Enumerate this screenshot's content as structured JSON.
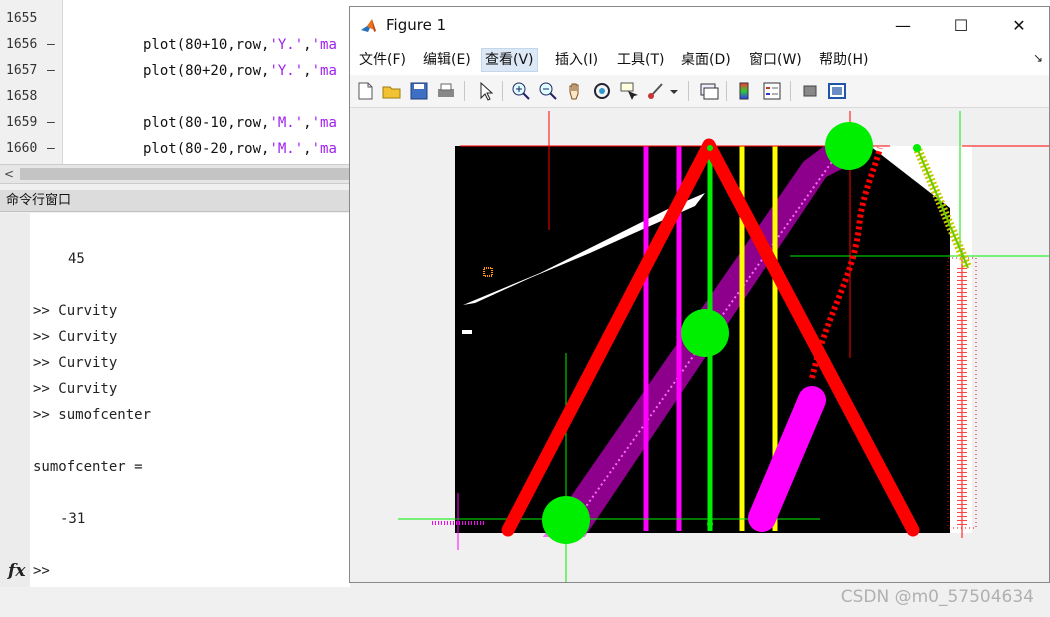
{
  "editor": {
    "lines": [
      {
        "num": "1655",
        "dash": "",
        "code": []
      },
      {
        "num": "1656",
        "dash": "—",
        "code": [
          {
            "t": "plot(80+10,row,",
            "c": "code"
          },
          {
            "t": "'Y.'",
            "c": "str"
          },
          {
            "t": ",",
            "c": "code"
          },
          {
            "t": "'ma",
            "c": "str"
          }
        ]
      },
      {
        "num": "1657",
        "dash": "—",
        "code": [
          {
            "t": "plot(80+20,row,",
            "c": "code"
          },
          {
            "t": "'Y.'",
            "c": "str"
          },
          {
            "t": ",",
            "c": "code"
          },
          {
            "t": "'ma",
            "c": "str"
          }
        ]
      },
      {
        "num": "1658",
        "dash": "",
        "code": []
      },
      {
        "num": "1659",
        "dash": "—",
        "code": [
          {
            "t": "plot(80-10,row,",
            "c": "code"
          },
          {
            "t": "'M.'",
            "c": "str"
          },
          {
            "t": ",",
            "c": "code"
          },
          {
            "t": "'ma",
            "c": "str"
          }
        ]
      },
      {
        "num": "1660",
        "dash": "—",
        "code": [
          {
            "t": "plot(80-20,row,",
            "c": "code"
          },
          {
            "t": "'M.'",
            "c": "str"
          },
          {
            "t": ",",
            "c": "code"
          },
          {
            "t": "'ma",
            "c": "str"
          }
        ]
      }
    ],
    "scroll_left_glyph": "<"
  },
  "command_window": {
    "title": "命令行窗口",
    "value_45": "45",
    "history": [
      ">> Curvity",
      ">> Curvity",
      ">> Curvity",
      ">> Curvity",
      ">> sumofcenter"
    ],
    "result_label": "sumofcenter =",
    "result_value": "-31",
    "fx_label": "fx",
    "prompt": ">>"
  },
  "figure": {
    "title": "Figure 1",
    "minimize": "—",
    "maximize": "☐",
    "close": "✕",
    "menus": [
      "文件(F)",
      "编辑(E)",
      "查看(V)",
      "插入(I)",
      "工具(T)",
      "桌面(D)",
      "窗口(W)",
      "帮助(H)"
    ],
    "active_menu_index": 2,
    "menu_overflow_glyph": "↘",
    "toolbar_icons": [
      "new-figure-icon",
      "open-file-icon",
      "save-icon",
      "print-icon",
      "pointer-icon",
      "zoom-in-icon",
      "zoom-out-icon",
      "pan-hand-icon",
      "rotate-3d-icon",
      "data-cursor-icon",
      "brush-icon",
      "dropdown-arrow-icon",
      "link-plot-icon",
      "colorbar-icon",
      "legend-icon",
      "hide-tools-icon",
      "show-tools-icon"
    ]
  },
  "plot": {
    "colors": {
      "red": "#ff0000",
      "green": "#00ee00",
      "magenta": "#ff00ff",
      "yellow": "#ffff00",
      "black": "#000000",
      "white": "#ffffff"
    }
  },
  "watermark": "CSDN @m0_57504634"
}
